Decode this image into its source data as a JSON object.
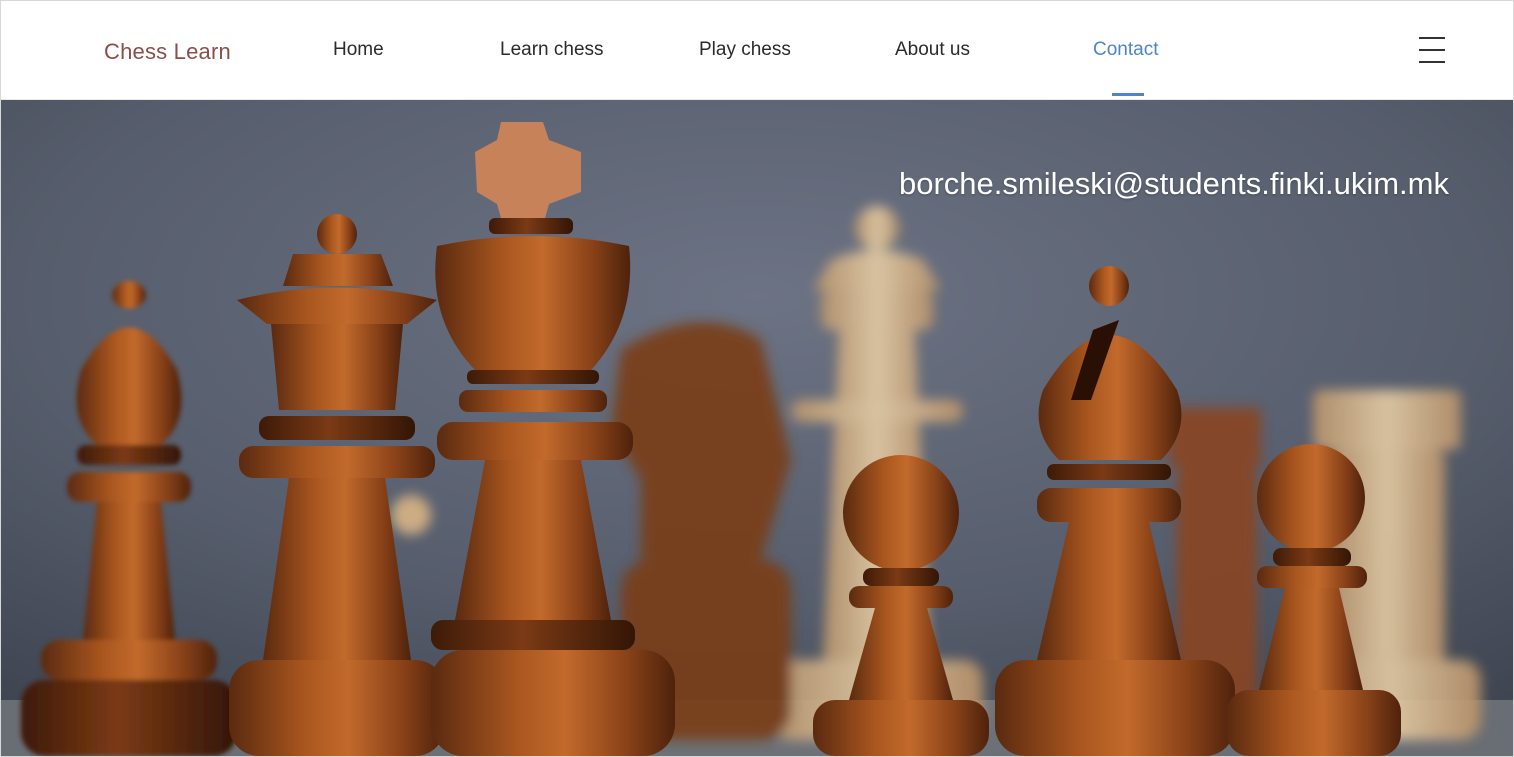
{
  "brand": {
    "name": "Chess Learn"
  },
  "nav": {
    "items": [
      {
        "label": "Home"
      },
      {
        "label": "Learn chess"
      },
      {
        "label": "Play chess"
      },
      {
        "label": "About us"
      },
      {
        "label": "Contact",
        "active": true
      }
    ],
    "menu_icon": "hamburger-menu-icon"
  },
  "hero": {
    "email": "borche.smileski@students.finki.ukim.mk",
    "image": "chess-pieces-photo"
  },
  "colors": {
    "brand": "#8b4f4a",
    "active": "#4a86c8",
    "text": "#2b2b2b",
    "hero_background": "#5a6272"
  }
}
